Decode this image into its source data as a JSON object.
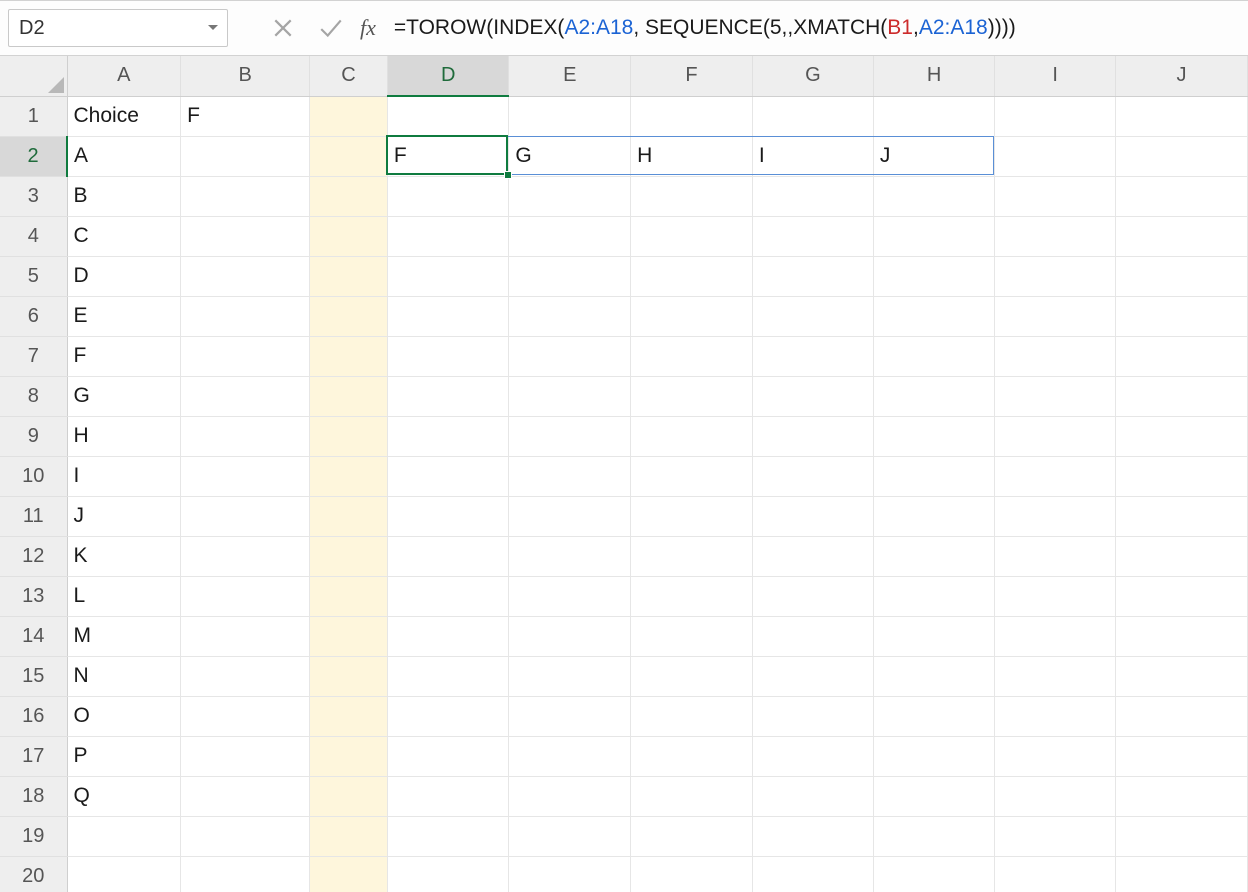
{
  "name_box": {
    "value": "D2"
  },
  "formula_bar": {
    "fx_label": "fx",
    "tokens": [
      {
        "t": "=TOROW(INDEX(",
        "c": "black"
      },
      {
        "t": "A2:A18",
        "c": "blue"
      },
      {
        "t": ", SEQUENCE(5,,XMATCH(",
        "c": "black"
      },
      {
        "t": "B1",
        "c": "red"
      },
      {
        "t": ", ",
        "c": "black"
      },
      {
        "t": "A2:A18",
        "c": "blue"
      },
      {
        "t": "))))",
        "c": "black"
      }
    ]
  },
  "columns": [
    "A",
    "B",
    "C",
    "D",
    "E",
    "F",
    "G",
    "H",
    "I",
    "J"
  ],
  "row_count": 20,
  "highlighted_column": "C",
  "selected_column": "D",
  "selected_row": 2,
  "cells": {
    "A1": "Choice",
    "B1": "F",
    "A2": "A",
    "A3": "B",
    "A4": "C",
    "A5": "D",
    "A6": "E",
    "A7": "F",
    "A8": "G",
    "A9": "H",
    "A10": "I",
    "A11": "J",
    "A12": "K",
    "A13": "L",
    "A14": "M",
    "A15": "N",
    "A16": "O",
    "A17": "P",
    "A18": "Q",
    "D2": "F",
    "E2": "G",
    "F2": "H",
    "G2": "I",
    "H2": "J"
  },
  "active_cell": "D2",
  "spill_range": {
    "start": "D2",
    "end": "H2"
  }
}
